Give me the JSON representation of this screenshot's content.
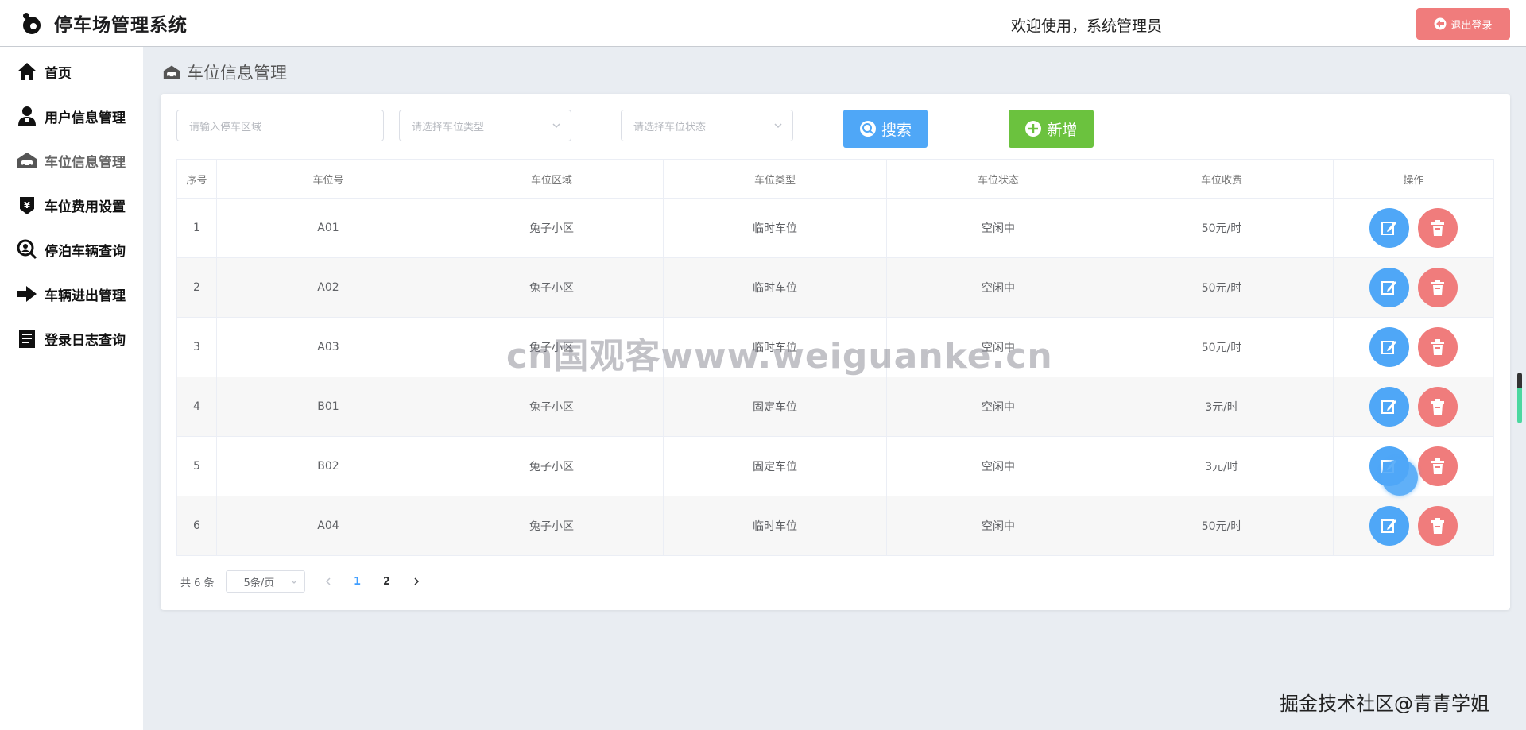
{
  "header": {
    "app_title": "停车场管理系统",
    "welcome": "欢迎使用，系统管理员",
    "logout_label": "退出登录"
  },
  "sidebar": {
    "items": [
      {
        "label": "首页",
        "icon": "home-icon"
      },
      {
        "label": "用户信息管理",
        "icon": "user-icon"
      },
      {
        "label": "车位信息管理",
        "icon": "garage-icon",
        "active": true
      },
      {
        "label": "车位费用设置",
        "icon": "fee-icon"
      },
      {
        "label": "停泊车辆查询",
        "icon": "search-person-icon"
      },
      {
        "label": "车辆进出管理",
        "icon": "arrow-right-icon"
      },
      {
        "label": "登录日志查询",
        "icon": "document-icon"
      }
    ]
  },
  "page": {
    "title": "车位信息管理"
  },
  "filters": {
    "area_placeholder": "请输入停车区域",
    "type_placeholder": "请选择车位类型",
    "status_placeholder": "请选择车位状态",
    "search_label": "搜索",
    "add_label": "新增"
  },
  "table": {
    "headers": [
      "序号",
      "车位号",
      "车位区域",
      "车位类型",
      "车位状态",
      "车位收费",
      "操作"
    ],
    "rows": [
      {
        "no": "1",
        "code": "A01",
        "area": "兔子小区",
        "type": "临时车位",
        "status": "空闲中",
        "fee": "50元/时"
      },
      {
        "no": "2",
        "code": "A02",
        "area": "兔子小区",
        "type": "临时车位",
        "status": "空闲中",
        "fee": "50元/时"
      },
      {
        "no": "3",
        "code": "A03",
        "area": "兔子小区",
        "type": "临时车位",
        "status": "空闲中",
        "fee": "50元/时"
      },
      {
        "no": "4",
        "code": "B01",
        "area": "兔子小区",
        "type": "固定车位",
        "status": "空闲中",
        "fee": "3元/时"
      },
      {
        "no": "5",
        "code": "B02",
        "area": "兔子小区",
        "type": "固定车位",
        "status": "空闲中",
        "fee": "3元/时"
      },
      {
        "no": "6",
        "code": "A04",
        "area": "兔子小区",
        "type": "临时车位",
        "status": "空闲中",
        "fee": "50元/时"
      }
    ]
  },
  "pagination": {
    "total_text": "共 6 条",
    "page_size": "5条/页",
    "pages": [
      "1",
      "2"
    ],
    "current": "1"
  },
  "overlays": {
    "watermark": "cn国观客www.weiguanke.cn",
    "footer_mark": "掘金技术社区@青青学姐"
  },
  "colors": {
    "primary": "#4fa7f7",
    "success": "#6bc23e",
    "danger": "#f07c7c"
  }
}
